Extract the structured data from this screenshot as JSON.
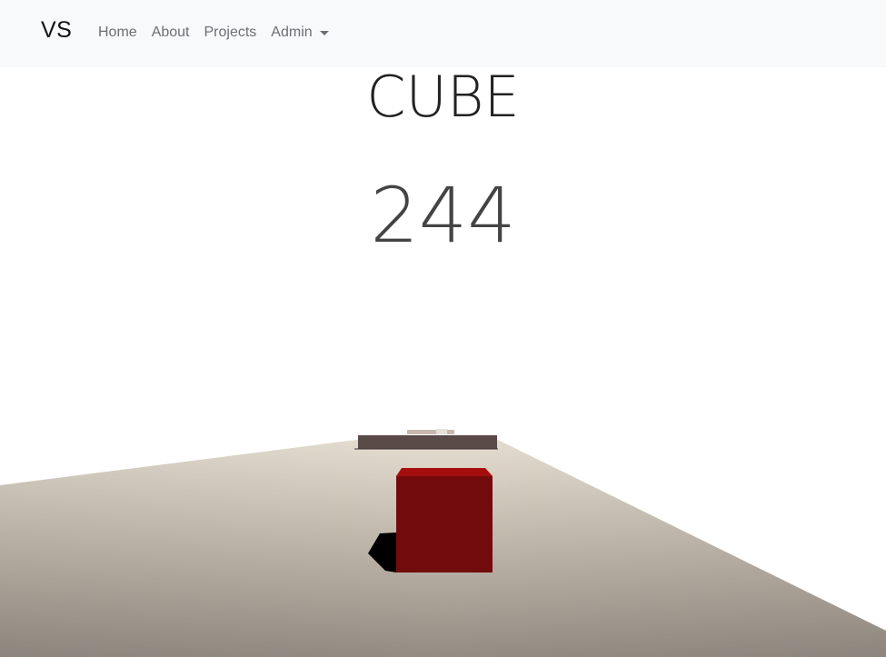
{
  "navbar": {
    "brand": "VS",
    "items": [
      {
        "label": "Home"
      },
      {
        "label": "About"
      },
      {
        "label": "Projects"
      },
      {
        "label": "Admin",
        "dropdown": true
      }
    ]
  },
  "game": {
    "title": "CUBE",
    "score": "244"
  },
  "colors": {
    "navbar_bg": "#f8f9fa",
    "floor_light": "#e3dbd0",
    "floor_dark": "#9b948b",
    "cube_front": "#720c0c",
    "cube_top": "#a30d0d",
    "obstacle": "#5a4a48",
    "shadow": "#000000"
  }
}
